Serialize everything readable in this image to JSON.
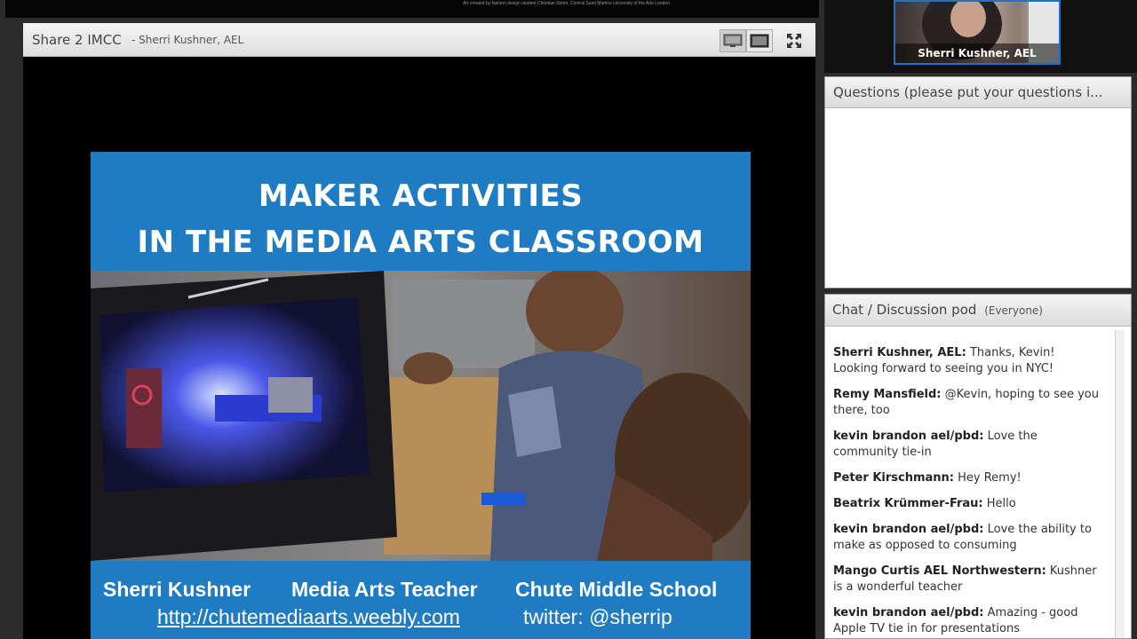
{
  "top_strip": {
    "credit": "Art created by fashion design student Christian Stone, Central Saint Martins University of the Arts London"
  },
  "share_pod": {
    "title": "Share 2 IMCC",
    "presenter": "- Sherri Kushner, AEL"
  },
  "slide": {
    "title_line1": "MAKER ACTIVITIES",
    "title_line2": "IN THE MEDIA ARTS CLASSROOM",
    "footer_name": "Sherri Kushner",
    "footer_role": "Media Arts Teacher",
    "footer_school": "Chute Middle School",
    "footer_link": "http://chutemediaarts.weebly.com",
    "footer_twitter": "twitter: @sherrip"
  },
  "camera": {
    "name": "Sherri Kushner, AEL"
  },
  "questions_pod": {
    "title": "Questions (please put your questions i..."
  },
  "chat_pod": {
    "title": "Chat / Discussion pod",
    "audience": "(Everyone)",
    "messages": [
      {
        "who": "Sherri Kushner, AEL:",
        "text": "Thanks, Kevin!  Looking forward to seeing you in NYC!"
      },
      {
        "who": "Remy Mansfield:",
        "text": "@Kevin, hoping to see you there, too"
      },
      {
        "who": "kevin brandon ael/pbd:",
        "text": "Love the community tie-in"
      },
      {
        "who": "Peter Kirschmann:",
        "text": "Hey Remy!"
      },
      {
        "who": "Beatrix Krümmer-Frau:",
        "text": "Hello"
      },
      {
        "who": "kevin brandon ael/pbd:",
        "text": "Love the ability to make as opposed to consuming"
      },
      {
        "who": "Mango Curtis AEL Northwestern:",
        "text": "Kushner is a wonderful teacher"
      },
      {
        "who": "kevin brandon ael/pbd:",
        "text": "Amazing - good Apple TV tie in for presentations"
      }
    ]
  },
  "colors": {
    "slide_blue": "#1f7cc2",
    "camera_border": "#1f72c8"
  },
  "icons": [
    "webcam-view-icon",
    "filmstrip-view-icon",
    "fullscreen-icon"
  ]
}
